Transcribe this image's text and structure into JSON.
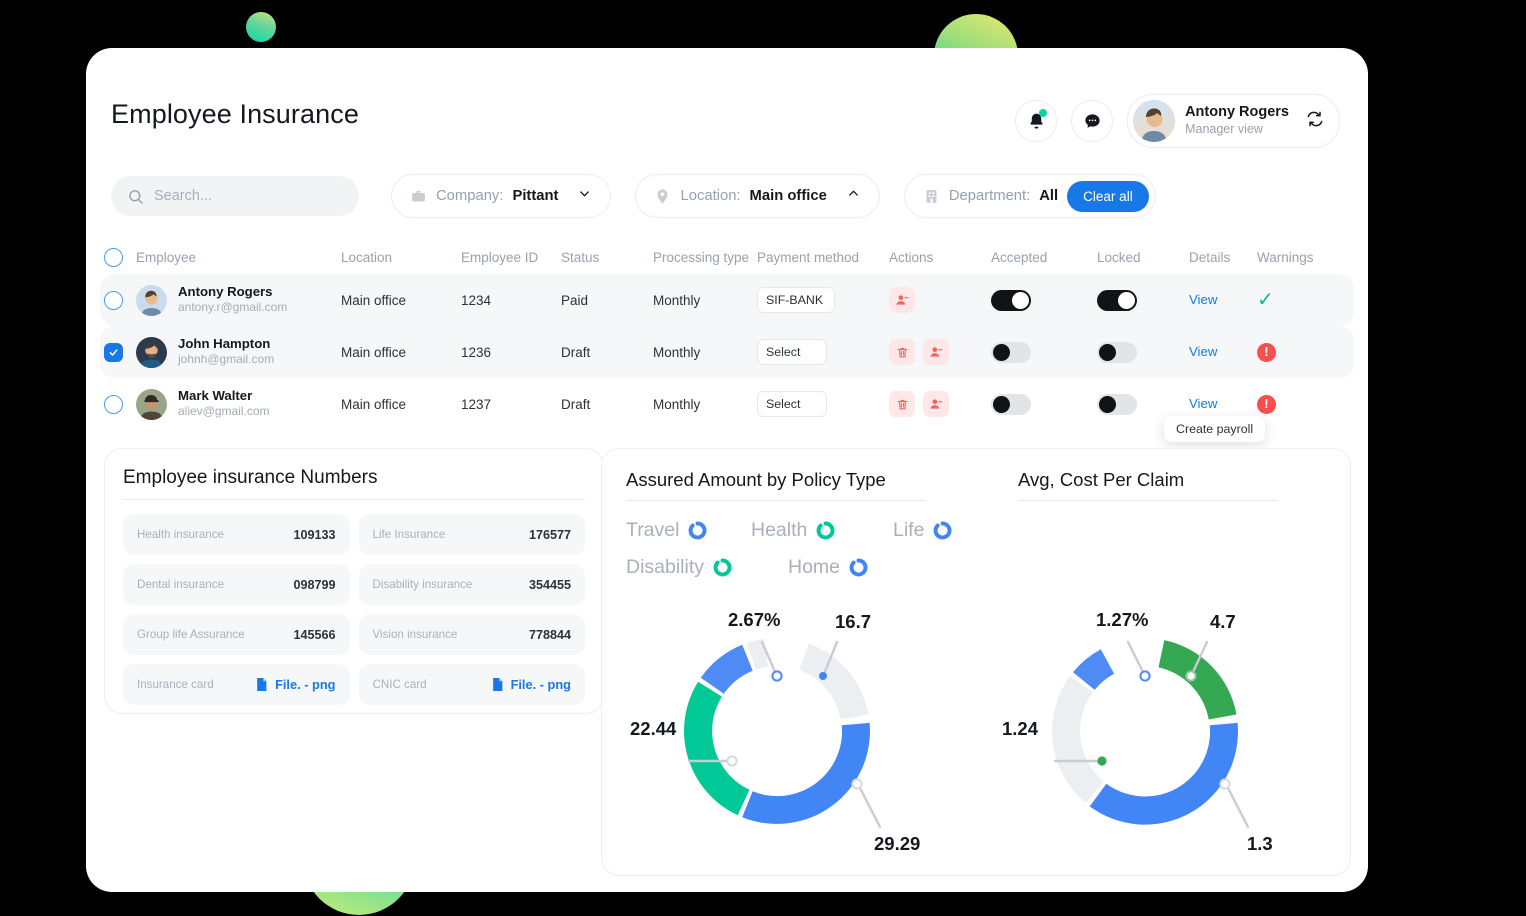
{
  "header": {
    "title": "Employee Insurance",
    "notifications_icon": "bell-icon",
    "messages_icon": "chat-icon",
    "profile": {
      "name": "Antony Rogers",
      "role": "Manager view",
      "sync_icon": "sync-icon"
    }
  },
  "filters": {
    "search": {
      "placeholder": "Search...",
      "value": ""
    },
    "company": {
      "label": "Company:",
      "value": "Pittant"
    },
    "location": {
      "label": "Location:",
      "value": "Main office"
    },
    "department": {
      "label": "Department:",
      "value": "All"
    },
    "clear_all": "Clear all"
  },
  "table": {
    "columns": [
      "Employee",
      "Location",
      "Employee ID",
      "Status",
      "Processing type",
      "Payment method",
      "Actions",
      "Accepted",
      "Locked",
      "Details",
      "Warnings"
    ],
    "details_link": "View",
    "rows": [
      {
        "selected": false,
        "name": "Antony Rogers",
        "email": "antony.r@gmail.com",
        "location": "Main office",
        "employee_id": "1234",
        "status": "Paid",
        "processing_type": "Monthly",
        "payment_method": "SIF-BANK",
        "actions": [
          "add-user-icon"
        ],
        "accepted": true,
        "locked": true,
        "warning": "ok"
      },
      {
        "selected": true,
        "name": "John Hampton",
        "email": "johnh@gmail.com",
        "location": "Main office",
        "employee_id": "1236",
        "status": "Draft",
        "processing_type": "Monthly",
        "payment_method": "Select",
        "actions": [
          "trash-icon",
          "add-user-icon"
        ],
        "accepted": false,
        "locked": false,
        "warning": "error"
      },
      {
        "selected": false,
        "name": "Mark Walter",
        "email": "aliev@gmail.com",
        "location": "Main office",
        "employee_id": "1237",
        "status": "Draft",
        "processing_type": "Monthly",
        "payment_method": "Select",
        "actions": [
          "trash-icon",
          "add-user-icon"
        ],
        "accepted": false,
        "locked": false,
        "warning": "error"
      }
    ],
    "tooltip": "Create payroll"
  },
  "insurance_card": {
    "title": "Employee insurance Numbers",
    "items": [
      {
        "label": "Health insurance",
        "value": "109133"
      },
      {
        "label": "Life Insurance",
        "value": "176577"
      },
      {
        "label": "Dental insurance",
        "value": "098799"
      },
      {
        "label": "Disability insurance",
        "value": "354455"
      },
      {
        "label": "Group life Assurance",
        "value": "145566"
      },
      {
        "label": "Vision insurance",
        "value": "778844"
      },
      {
        "label": "Insurance card",
        "value": "File. - png",
        "is_file": true
      },
      {
        "label": "CNIC card",
        "value": "File. - png",
        "is_file": true
      }
    ]
  },
  "colors": {
    "blue": "#4285F4",
    "blue_light": "#4f8bf5",
    "teal": "#00c896",
    "green": "#34a853",
    "grey": "#eceef2",
    "accent": "#1878e8",
    "danger": "#fa4d4d",
    "success": "#06c08a"
  },
  "chart_data": [
    {
      "type": "pie",
      "title": "Assured Amount by Policy Type",
      "legend": [
        {
          "label": "Travel",
          "color": "#4285F4"
        },
        {
          "label": "Health",
          "color": "#00c896"
        },
        {
          "label": "Life",
          "color": "#4285F4"
        },
        {
          "label": "Disability",
          "color": "#00c896"
        },
        {
          "label": "Home",
          "color": "#4285F4"
        }
      ],
      "legend_position": "top",
      "categories": [
        "Home",
        "Travel",
        "Life",
        "Health",
        "Disability"
      ],
      "labels": [
        "16.7",
        "29.29",
        "22.44",
        "2.67%",
        ""
      ],
      "values": [
        16.7,
        29.29,
        22.44,
        2.67,
        8.9
      ],
      "colors": [
        "#eceef2",
        "#4285F4",
        "#00c896",
        "#4f8bf5",
        "#eceef2"
      ]
    },
    {
      "type": "pie",
      "title": "Avg, Cost Per Claim",
      "categories": [
        "Health",
        "Travel",
        "Life",
        "Disability"
      ],
      "labels": [
        "4.7",
        "1.3",
        "1.24",
        "1.27%"
      ],
      "values": [
        4.7,
        1.3,
        1.24,
        1.27
      ],
      "colors": [
        "#34a853",
        "#4285F4",
        "#eceef2",
        "#4f8bf5"
      ]
    }
  ]
}
